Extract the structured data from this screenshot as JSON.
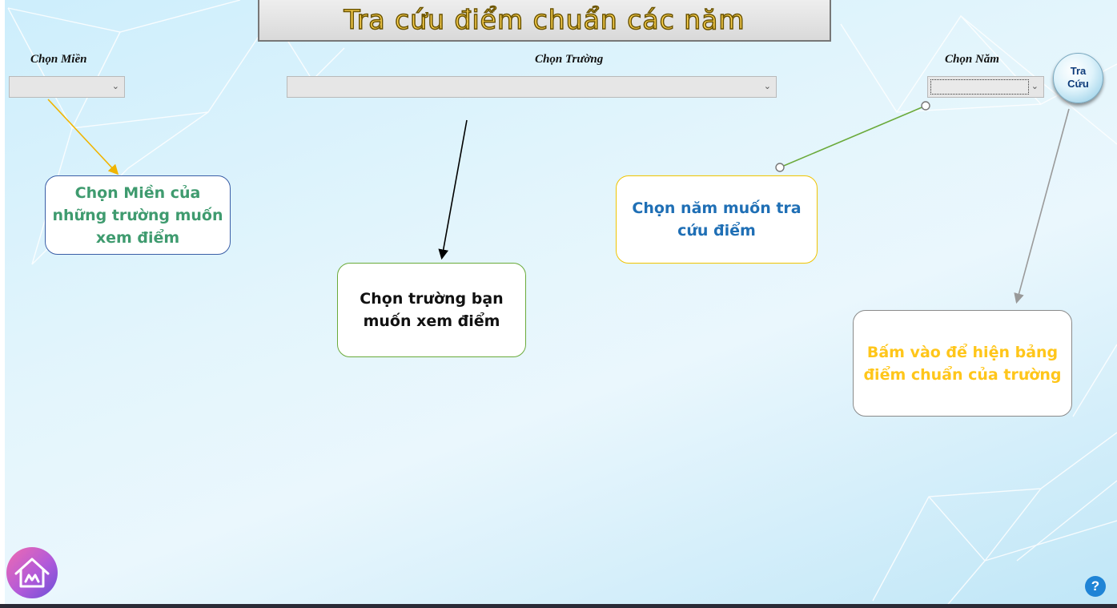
{
  "header": {
    "title": "Tra cứu điểm chuẩn các năm",
    "faint_text": "..."
  },
  "filters": {
    "region": {
      "label": "Chọn Miền",
      "value": ""
    },
    "school": {
      "label": "Chọn Trường",
      "value": ""
    },
    "year": {
      "label": "Chọn Năm",
      "value": ""
    }
  },
  "search_button": {
    "line1": "Tra",
    "line2": "Cứu"
  },
  "callouts": {
    "region": "Chọn Miền của những trường muốn xem điểm",
    "school": "Chọn trường bạn muốn xem điểm",
    "year": "Chọn năm muốn tra cứu điểm",
    "search": "Bấm vào để hiện bảng điểm chuẩn của trường"
  },
  "icons": {
    "home": "home-icon",
    "help": "question-icon",
    "chevron": "chevron-down-icon"
  },
  "help_button": {
    "label": "?"
  },
  "colors": {
    "title_fill": "#ffd451",
    "region_text": "#3f9b6f",
    "year_text": "#1f6fb5",
    "search_text": "#ffc61a"
  }
}
